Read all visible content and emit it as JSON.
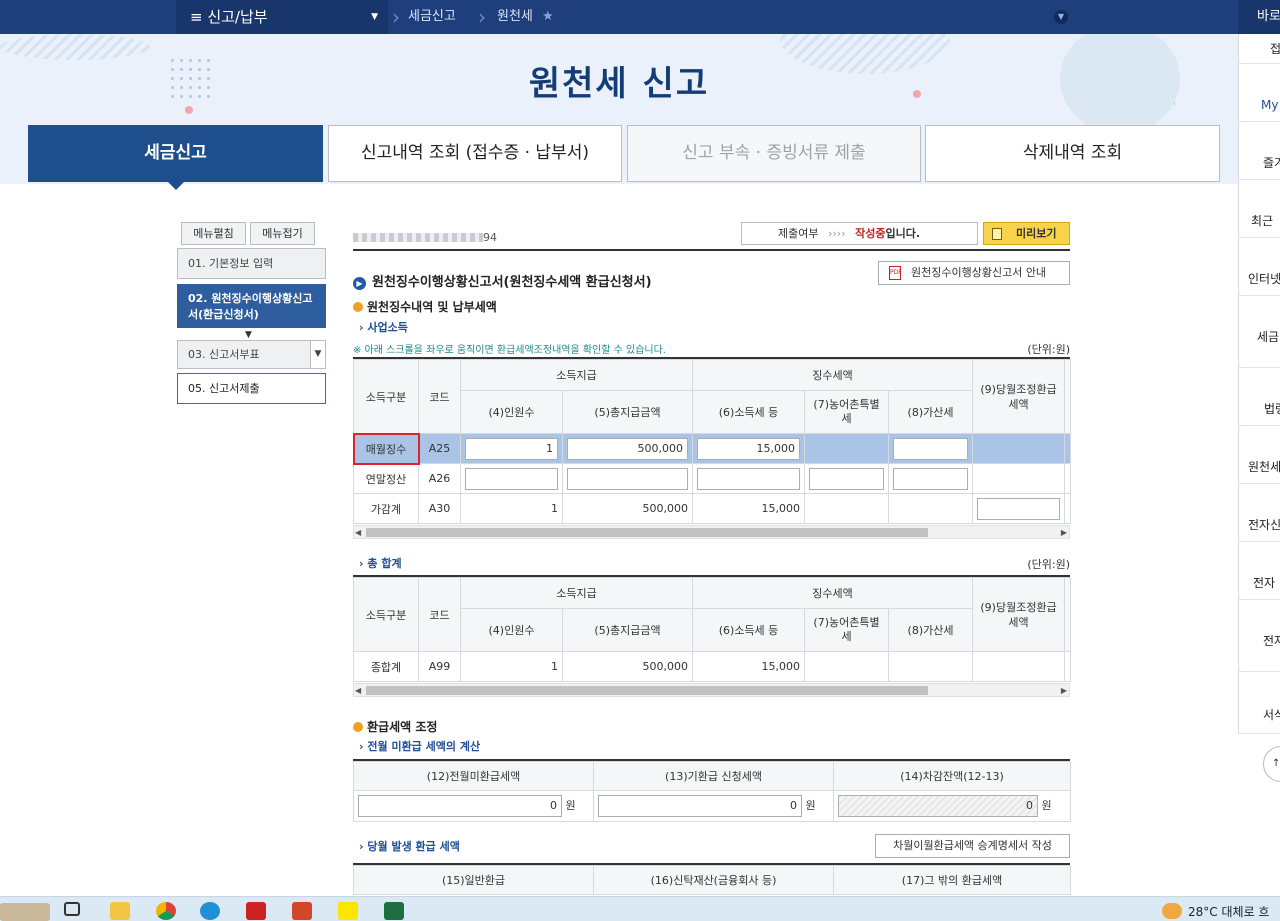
{
  "topbar": {
    "menu": "≡ 신고/납부",
    "crumb1": "세금신고",
    "crumb2": "원천세",
    "right_label": "바로"
  },
  "hero": {
    "title": "원천세 신고"
  },
  "tabs": [
    {
      "label": "세금신고"
    },
    {
      "label": "신고내역 조회 (접수증 · 납부서)"
    },
    {
      "label": "신고 부속 · 증빙서류 제출"
    },
    {
      "label": "삭제내역 조회"
    }
  ],
  "sidemenu": {
    "expand": "메뉴펼침",
    "collapse": "메뉴접기",
    "steps": [
      "01. 기본정보 입력",
      "02. 원천징수이행상황신고서(환급신청서)",
      "03. 신고서부표",
      "05. 신고서제출"
    ]
  },
  "main": {
    "id_suffix": "94",
    "status_label": "제출여부",
    "status_arrows": "››››",
    "status_value": "작성중",
    "status_suffix": "입니다.",
    "preview_button": "미리보기",
    "form_title": "원천징수이행상황신고서(원천징수세액 환급신청서)",
    "guide_button": "원천징수이행상황신고서 안내",
    "section1": "원천징수내역 및 납부세액",
    "sub_business": "사업소득",
    "notice": "※ 아래 스크롤을 좌우로 움직이면 환급세액조정내역을 확인할 수 있습니다.",
    "unit": "(단위:원)",
    "table_headers": {
      "category": "소득구분",
      "code": "코드",
      "income": "소득지급",
      "tax": "징수세액",
      "c4": "(4)인원수",
      "c5": "(5)총지급금액",
      "c6": "(6)소득세 등",
      "c7": "(7)농어촌특별세",
      "c8": "(8)가산세",
      "c9": "(9)당월조정환급세액"
    },
    "rows": [
      {
        "label": "매월징수",
        "code": "A25",
        "people": "1",
        "amount": "500,000",
        "tax": "15,000"
      },
      {
        "label": "연말정산",
        "code": "A26"
      },
      {
        "label": "가감계",
        "code": "A30",
        "people": "1",
        "amount": "500,000",
        "tax": "15,000"
      }
    ],
    "sub_total": "총 합계",
    "total_row": {
      "label": "종합계",
      "code": "A99",
      "people": "1",
      "amount": "500,000",
      "tax": "15,000"
    },
    "section2": "환급세액 조정",
    "sub_prev": "전월 미환급 세액의 계산",
    "refund_headers": [
      "(12)전월미환급세액",
      "(13)기환급 신청세액",
      "(14)차감잔액(12-13)"
    ],
    "refund_values": [
      "0",
      "0",
      "0"
    ],
    "won": "원",
    "sub_current": "당월 발생 환급 세액",
    "carry_button": "차월이월환급세액 승계명세서 작성",
    "current_headers": [
      "(15)일반환급",
      "(16)신탁재산(금융회사 등)",
      "(17)그 밖의 환급세액"
    ]
  },
  "right_sidebar": [
    "접",
    "My",
    "즐겨",
    "최근",
    "인터넷",
    "세금",
    "법령",
    "원천세",
    "전자신",
    "전자",
    "전자가",
    "서식"
  ],
  "taskbar": {
    "weather": "28°C",
    "weather_text": "대체로 흐"
  }
}
